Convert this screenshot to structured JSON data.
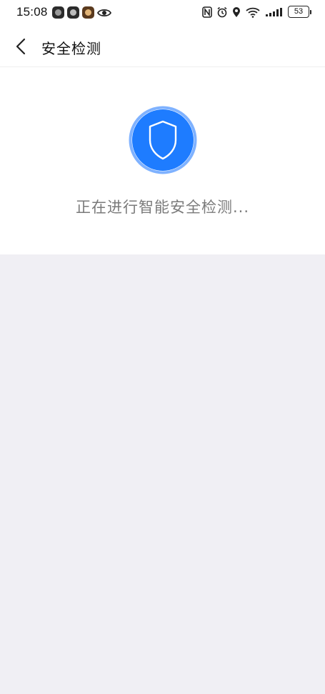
{
  "status_bar": {
    "time": "15:08",
    "battery": "53",
    "left_icons": [
      "camera-app-icon",
      "camera-app-icon",
      "camera-app-icon",
      "eye-icon"
    ],
    "right_icons": [
      "nfc-icon",
      "alarm-icon",
      "location-icon",
      "wifi-icon",
      "signal-icon",
      "battery-icon"
    ]
  },
  "header": {
    "back_icon": "chevron-left-icon",
    "title": "安全检测"
  },
  "scan": {
    "icon": "shield-icon",
    "accent_color": "#1e7cff",
    "ring_color": "#7fb2ff",
    "message": "正在进行智能安全检测..."
  },
  "colors": {
    "background": "#f0eff4",
    "card": "#ffffff",
    "text_secondary": "#7a7a7a"
  }
}
